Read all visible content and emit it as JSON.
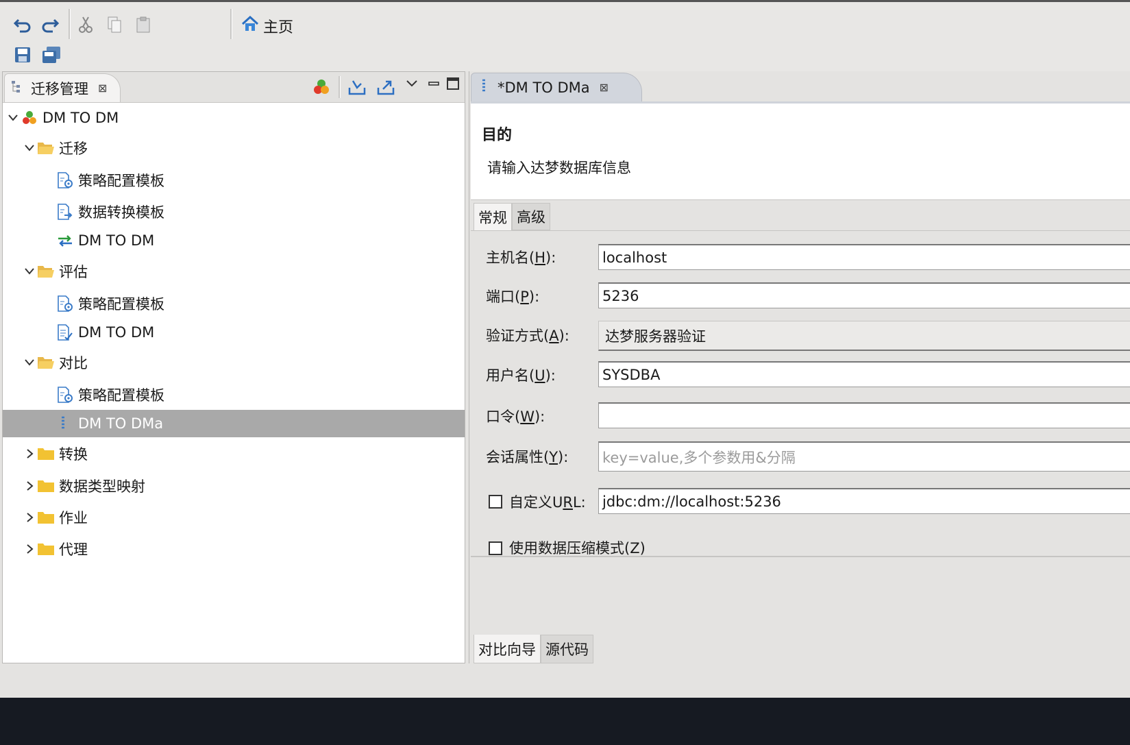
{
  "toolbar": {
    "home_label": "主页",
    "buttons": [
      "undo-icon",
      "redo-icon",
      "cut-icon",
      "copy-icon",
      "paste-icon",
      "save-icon",
      "save-all-icon"
    ]
  },
  "left_panel": {
    "tab_label": "迁移管理",
    "tree": [
      {
        "label": "DM TO DM"
      },
      {
        "label": "迁移"
      },
      {
        "label": "策略配置模板"
      },
      {
        "label": "数据转换模板"
      },
      {
        "label": "DM TO DM"
      },
      {
        "label": "评估"
      },
      {
        "label": "策略配置模板"
      },
      {
        "label": "DM TO DM"
      },
      {
        "label": "对比"
      },
      {
        "label": "策略配置模板"
      },
      {
        "label": "DM TO DMa"
      },
      {
        "label": "转换"
      },
      {
        "label": "数据类型映射"
      },
      {
        "label": "作业"
      },
      {
        "label": "代理"
      }
    ]
  },
  "editor": {
    "tab_label": "*DM TO DMa",
    "title": "目的",
    "description": "请输入达梦数据库信息",
    "tabs": [
      "常规",
      "高级"
    ],
    "form": {
      "host": {
        "label_pre": "主机名(",
        "key": "H",
        "label_post": "):",
        "value": "localhost"
      },
      "port": {
        "label_pre": "端口(",
        "key": "P",
        "label_post": "):",
        "value": "5236"
      },
      "auth": {
        "label_pre": "验证方式(",
        "key": "A",
        "label_post": "):",
        "value": "达梦服务器验证"
      },
      "user": {
        "label_pre": "用户名(",
        "key": "U",
        "label_post": "):",
        "value": "SYSDBA"
      },
      "password": {
        "label_pre": "口令(",
        "key": "W",
        "label_post": "):",
        "value": ""
      },
      "session": {
        "label_pre": "会话属性(",
        "key": "Y",
        "label_post": "):",
        "placeholder": "key=value,多个参数用&分隔"
      },
      "custom_url": {
        "label_pre": "自定义U",
        "key": "R",
        "label_post": "L:",
        "value": "jdbc:dm://localhost:5236",
        "checked": false
      },
      "compress": {
        "label": "使用数据压缩模式(Z)",
        "checked": false
      }
    },
    "bottom_tabs": [
      "对比向导",
      "源代码"
    ]
  }
}
